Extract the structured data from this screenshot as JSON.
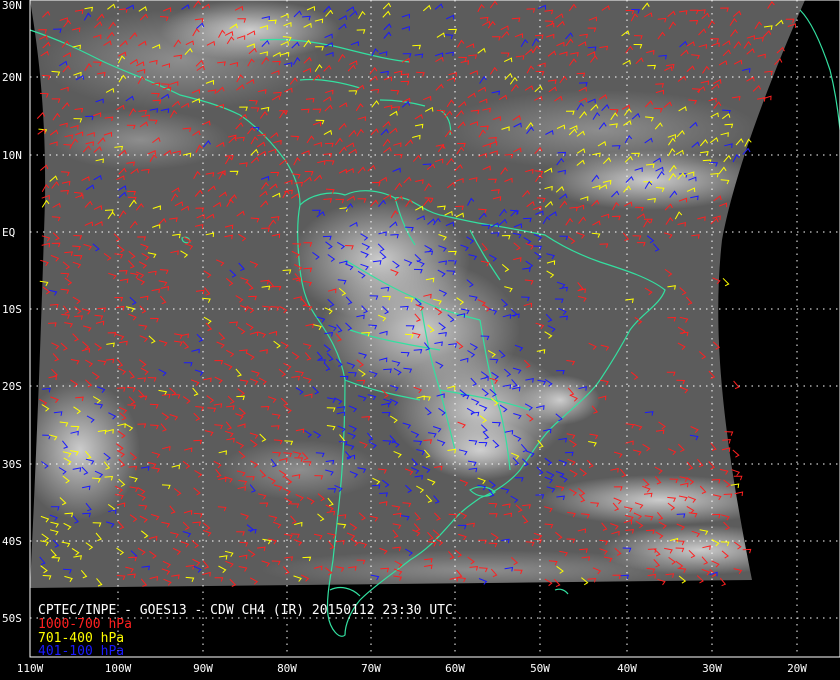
{
  "map": {
    "title": "CPTEC/INPE - GOES13 - CDW CH4 (IR) 20150112 23:30 UTC",
    "lat_labels": [
      "30N",
      "20N",
      "10N",
      "EQ",
      "10S",
      "20S",
      "30S",
      "40S",
      "50S"
    ],
    "lon_labels": [
      "110W",
      "100W",
      "90W",
      "80W",
      "70W",
      "60W",
      "50W",
      "40W",
      "30W",
      "20W"
    ],
    "legend": [
      {
        "label": "1000-700 hPa",
        "color": "#ff2020"
      },
      {
        "label": "701-400 hPa",
        "color": "#ffff00"
      },
      {
        "label": "401-100 hPa",
        "color": "#1a1aff"
      }
    ],
    "colors": {
      "background": "#000000",
      "imagery": "#5a5a5a",
      "coastline": "#33e0a0",
      "grid": "#ffffff"
    }
  }
}
